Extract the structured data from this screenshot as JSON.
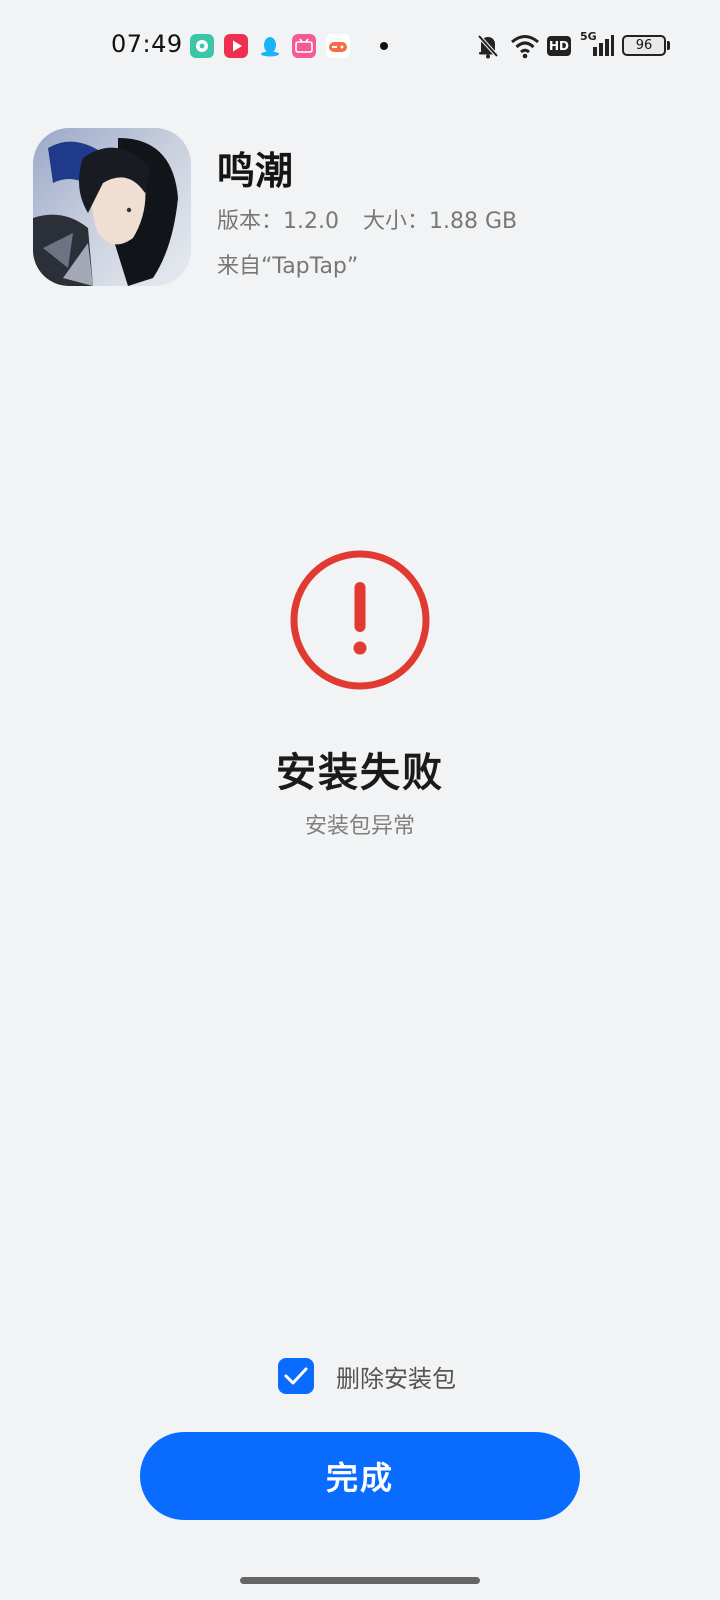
{
  "status_bar": {
    "time": "07:49",
    "notification_icons": [
      "chat-bubble-icon",
      "video-play-icon",
      "qq-penguin-icon",
      "bilibili-icon",
      "game-controller-icon",
      "more-dot-icon"
    ],
    "system_icons": [
      "mute-bell-icon",
      "wifi-icon",
      "hd-icon",
      "5g-signal-icon"
    ],
    "hd_label": "HD",
    "network_label": "5G",
    "battery": "96"
  },
  "app": {
    "name": "鸣潮",
    "version_label": "版本：1.2.0",
    "size_label": "大小：1.88 GB",
    "source": "来自“TapTap”",
    "icon": "app-icon-anime-girl"
  },
  "result": {
    "title": "安装失败",
    "description": "安装包异常",
    "icon": "error-exclamation-icon",
    "color": "#e03a32"
  },
  "actions": {
    "delete_package_label": "删除安装包",
    "delete_package_checked": true,
    "done_label": "完成"
  },
  "colors": {
    "accent": "#0a6cff",
    "background": "#f1f3f5",
    "error": "#e03a32"
  }
}
